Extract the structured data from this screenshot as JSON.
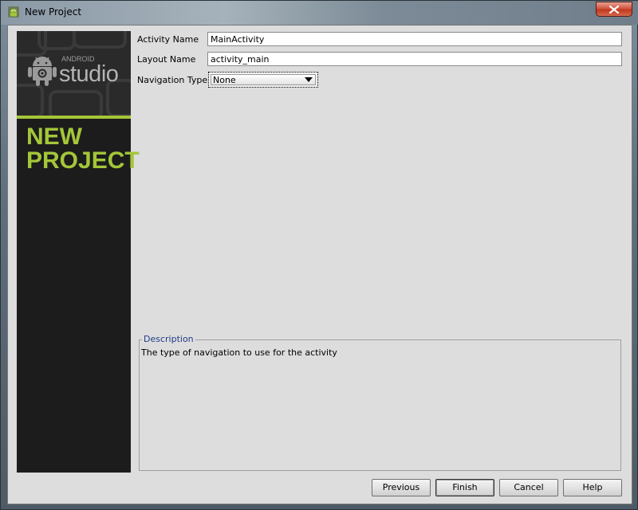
{
  "window": {
    "title": "New Project"
  },
  "banner": {
    "logo_small": "ANDROID",
    "logo_large": "studio",
    "heading_line1": "NEW",
    "heading_line2": "PROJECT",
    "accent_color": "#a4c639"
  },
  "form": {
    "activity_name_label": "Activity Name",
    "activity_name_value": "MainActivity",
    "layout_name_label": "Layout Name",
    "layout_name_value": "activity_main",
    "navigation_type_label": "Navigation Type",
    "navigation_type_value": "None"
  },
  "description": {
    "legend": "Description",
    "text": "The type of navigation to use for the activity"
  },
  "buttons": {
    "previous": "Previous",
    "finish": "Finish",
    "cancel": "Cancel",
    "help": "Help"
  },
  "icons": {
    "app": "android-icon",
    "close": "close-icon",
    "dropdown": "chevron-down-icon"
  }
}
